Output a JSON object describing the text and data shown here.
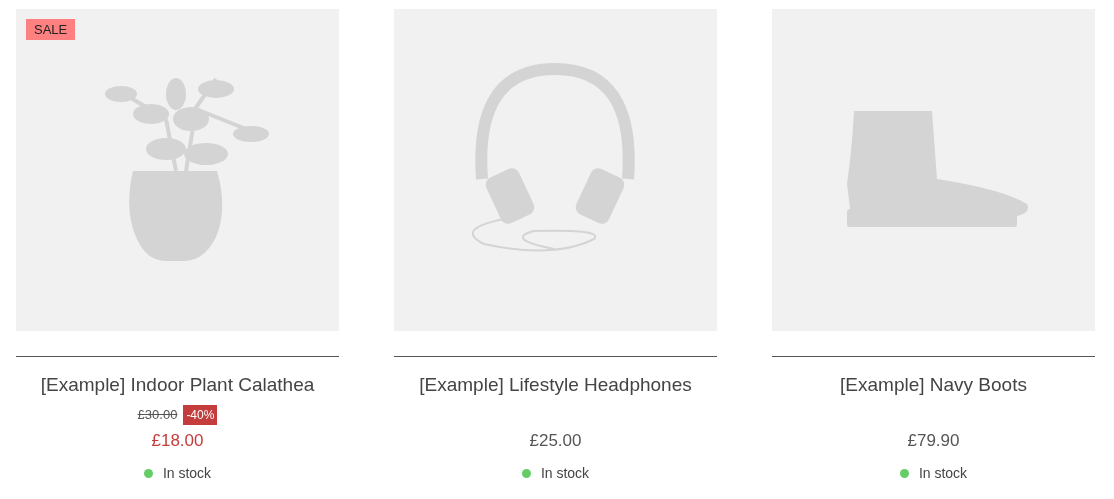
{
  "products": [
    {
      "badge": "SALE",
      "title": "[Example] Indoor Plant Calathea",
      "old_price": "£30.00",
      "discount": "-40%",
      "price": "£18.00",
      "on_sale": true,
      "stock": "In stock",
      "in_stock": true
    },
    {
      "title": "[Example] Lifestyle Headphones",
      "price": "£25.00",
      "on_sale": false,
      "stock": "In stock",
      "in_stock": true
    },
    {
      "title": "[Example] Navy Boots",
      "price": "£79.90",
      "on_sale": false,
      "stock": "In stock",
      "in_stock": true
    }
  ]
}
